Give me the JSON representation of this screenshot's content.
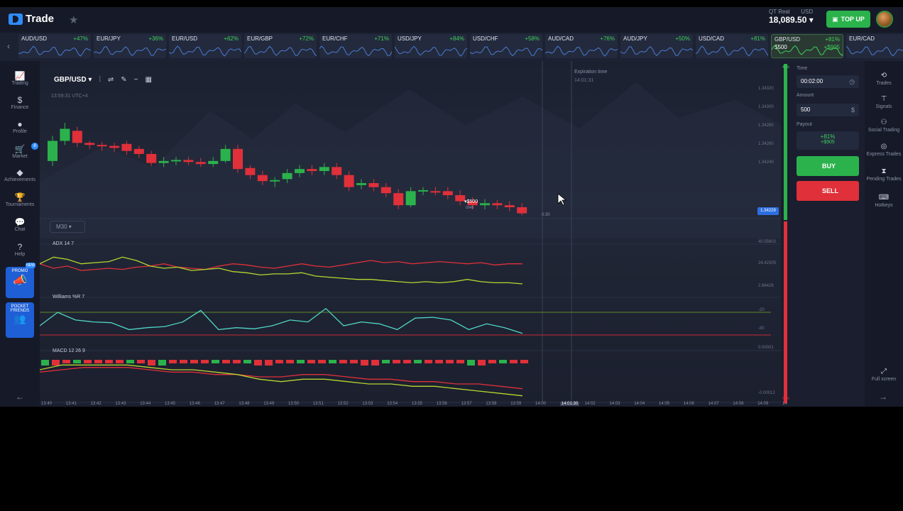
{
  "header": {
    "logo_text": "Trade",
    "account_type": "QT Real",
    "currency": "USD",
    "balance": "18,089.50",
    "topup_label": "TOP UP"
  },
  "assets": [
    {
      "name": "AUD/USD",
      "pct": "+47%"
    },
    {
      "name": "EUR/JPY",
      "pct": "+36%"
    },
    {
      "name": "EUR/USD",
      "pct": "+62%"
    },
    {
      "name": "EUR/GBP",
      "pct": "+72%"
    },
    {
      "name": "EUR/CHF",
      "pct": "+71%"
    },
    {
      "name": "USD/JPY",
      "pct": "+84%"
    },
    {
      "name": "USD/CHF",
      "pct": "+58%"
    },
    {
      "name": "AUD/CAD",
      "pct": "+76%"
    },
    {
      "name": "AUD/JPY",
      "pct": "+50%"
    },
    {
      "name": "USD/CAD",
      "pct": "+81%"
    },
    {
      "name": "GBP/USD",
      "pct": "+81%",
      "sub": "$500",
      "sub2": "+$905",
      "active": true
    },
    {
      "name": "EUR/CAD",
      "pct": ""
    }
  ],
  "leftnav": [
    {
      "icon": "chart-icon",
      "glyph": "📈",
      "label": "Trading"
    },
    {
      "icon": "dollar-icon",
      "glyph": "$",
      "label": "Finance"
    },
    {
      "icon": "user-icon",
      "glyph": "●",
      "label": "Profile"
    },
    {
      "icon": "cart-icon",
      "glyph": "🛒",
      "label": "Market",
      "badge": "8"
    },
    {
      "icon": "diamond-icon",
      "glyph": "◆",
      "label": "Achievements"
    },
    {
      "icon": "trophy-icon",
      "glyph": "🏆",
      "label": "Tournaments"
    },
    {
      "icon": "chat-icon",
      "glyph": "💬",
      "label": "Chat"
    },
    {
      "icon": "help-icon",
      "glyph": "?",
      "label": "Help"
    }
  ],
  "promo": {
    "label": "PROMO",
    "badge": "NEW"
  },
  "pocket_friends": {
    "label": "POCKET FRIENDS"
  },
  "toolbar": {
    "pair": "GBP/USD",
    "badge1": "5M",
    "badge2": "3"
  },
  "chart_info": {
    "timestamp": "13:59:31 UTC+4",
    "timeframe": "M30"
  },
  "expiration": {
    "label": "Expiration time",
    "time": "14:01:31"
  },
  "trade_marker": {
    "amount": "$500",
    "id": "0048"
  },
  "price_labels": [
    "1.34320",
    "1.34300",
    "1.34280",
    "1.34260",
    "1.34240"
  ],
  "current_price": "1.34229",
  "countdown": "0:30",
  "indicators": {
    "adx": {
      "label": "ADX 14 7",
      "vals": [
        "40.55602",
        "24.42305",
        "2.86426"
      ]
    },
    "williams": {
      "label": "Williams %R 7",
      "vals": [
        "-20",
        "-80"
      ]
    },
    "macd": {
      "label": "MACD 12 26 9",
      "vals": [
        "0.00001",
        "-0.00012"
      ]
    }
  },
  "time_labels": [
    "13:40",
    "13:41",
    "13:42",
    "13:43",
    "13:44",
    "13:45",
    "13:46",
    "13:47",
    "13:48",
    "13:49",
    "13:50",
    "13:51",
    "13:52",
    "13:53",
    "13:54",
    "13:55",
    "13:56",
    "13:57",
    "13:58",
    "13:59",
    "14:00",
    "14:01:30",
    "14:02",
    "14:03",
    "14:04",
    "14:05",
    "14:06",
    "14:07",
    "14:08",
    "14:09",
    "14"
  ],
  "volume_labels": {
    "top": "40%",
    "bottom": "60%"
  },
  "trade_panel": {
    "time_label": "Time",
    "time_value": "00:02:00",
    "amount_label": "Amount",
    "amount_value": "500",
    "payout_label": "Payout",
    "payout_pct": "+81%",
    "payout_amount": "+$905",
    "buy_label": "BUY",
    "sell_label": "SELL"
  },
  "rightnav": [
    {
      "icon": "history-icon",
      "glyph": "⟲",
      "label": "Trades"
    },
    {
      "icon": "signal-icon",
      "glyph": "⊤",
      "label": "Signals"
    },
    {
      "icon": "people-icon",
      "glyph": "⚇",
      "label": "Social Trading"
    },
    {
      "icon": "express-icon",
      "glyph": "◎",
      "label": "Express Trades"
    },
    {
      "icon": "hourglass-icon",
      "glyph": "⧗",
      "label": "Pending Trades"
    },
    {
      "icon": "keyboard-icon",
      "glyph": "⌨",
      "label": "Hotkeys"
    }
  ],
  "fullscreen": {
    "label": "Full screen"
  },
  "colors": {
    "green": "#2bb24c",
    "red": "#e0303a",
    "accent": "#2f8cff",
    "bg": "#1a1e2e"
  },
  "chart_data": {
    "type": "candlestick",
    "candles": [
      {
        "o": 1.3428,
        "c": 1.343,
        "h": 1.34305,
        "l": 1.34275
      },
      {
        "o": 1.343,
        "c": 1.34312,
        "h": 1.34318,
        "l": 1.34296
      },
      {
        "o": 1.3431,
        "c": 1.34298,
        "h": 1.34314,
        "l": 1.34294
      },
      {
        "o": 1.34298,
        "c": 1.34296,
        "h": 1.343,
        "l": 1.34292
      },
      {
        "o": 1.34296,
        "c": 1.34295,
        "h": 1.34299,
        "l": 1.3429
      },
      {
        "o": 1.34295,
        "c": 1.34293,
        "h": 1.34298,
        "l": 1.34289
      },
      {
        "o": 1.34297,
        "c": 1.3429,
        "h": 1.343,
        "l": 1.34286
      },
      {
        "o": 1.34292,
        "c": 1.34287,
        "h": 1.34295,
        "l": 1.34283
      },
      {
        "o": 1.34287,
        "c": 1.34278,
        "h": 1.3429,
        "l": 1.34275
      },
      {
        "o": 1.34278,
        "c": 1.3428,
        "h": 1.34284,
        "l": 1.34274
      },
      {
        "o": 1.3428,
        "c": 1.34281,
        "h": 1.34284,
        "l": 1.34276
      },
      {
        "o": 1.34281,
        "c": 1.34279,
        "h": 1.34284,
        "l": 1.34276
      },
      {
        "o": 1.34279,
        "c": 1.34277,
        "h": 1.34283,
        "l": 1.34274
      },
      {
        "o": 1.34277,
        "c": 1.3428,
        "h": 1.34284,
        "l": 1.34274
      },
      {
        "o": 1.3428,
        "c": 1.34292,
        "h": 1.34296,
        "l": 1.34278
      },
      {
        "o": 1.34292,
        "c": 1.34272,
        "h": 1.34296,
        "l": 1.34268
      },
      {
        "o": 1.34273,
        "c": 1.34266,
        "h": 1.34276,
        "l": 1.34262
      },
      {
        "o": 1.34266,
        "c": 1.3426,
        "h": 1.3427,
        "l": 1.34256
      },
      {
        "o": 1.3426,
        "c": 1.34261,
        "h": 1.34264,
        "l": 1.34254
      },
      {
        "o": 1.34262,
        "c": 1.34268,
        "h": 1.34272,
        "l": 1.34258
      },
      {
        "o": 1.34268,
        "c": 1.34272,
        "h": 1.34276,
        "l": 1.34264
      },
      {
        "o": 1.34272,
        "c": 1.3427,
        "h": 1.34276,
        "l": 1.34266
      },
      {
        "o": 1.3427,
        "c": 1.34274,
        "h": 1.34278,
        "l": 1.34266
      },
      {
        "o": 1.34274,
        "c": 1.34266,
        "h": 1.34278,
        "l": 1.34262
      },
      {
        "o": 1.34266,
        "c": 1.34254,
        "h": 1.3427,
        "l": 1.3425
      },
      {
        "o": 1.34256,
        "c": 1.34258,
        "h": 1.34262,
        "l": 1.34252
      },
      {
        "o": 1.34258,
        "c": 1.34254,
        "h": 1.34262,
        "l": 1.3425
      },
      {
        "o": 1.34254,
        "c": 1.34248,
        "h": 1.34258,
        "l": 1.34244
      },
      {
        "o": 1.34248,
        "c": 1.34236,
        "h": 1.34252,
        "l": 1.34232
      },
      {
        "o": 1.34236,
        "c": 1.3425,
        "h": 1.34254,
        "l": 1.34234
      },
      {
        "o": 1.3425,
        "c": 1.34251,
        "h": 1.34254,
        "l": 1.34246
      },
      {
        "o": 1.3425,
        "c": 1.34249,
        "h": 1.34254,
        "l": 1.34246
      },
      {
        "o": 1.3425,
        "c": 1.34246,
        "h": 1.34254,
        "l": 1.34242
      },
      {
        "o": 1.34246,
        "c": 1.3424,
        "h": 1.34251,
        "l": 1.34236
      },
      {
        "o": 1.3424,
        "c": 1.34236,
        "h": 1.34244,
        "l": 1.34232
      },
      {
        "o": 1.34236,
        "c": 1.34238,
        "h": 1.34242,
        "l": 1.34232
      },
      {
        "o": 1.34238,
        "c": 1.34236,
        "h": 1.34241,
        "l": 1.34232
      },
      {
        "o": 1.34236,
        "c": 1.34234,
        "h": 1.3424,
        "l": 1.3423
      },
      {
        "o": 1.34234,
        "c": 1.34228,
        "h": 1.34238,
        "l": 1.34226
      }
    ],
    "ylim": [
      1.3421,
      1.3433
    ],
    "adx_red": [
      30,
      26,
      28,
      24,
      25,
      26,
      25,
      27,
      28,
      30,
      27,
      26,
      25,
      28,
      30,
      29,
      27,
      26,
      28,
      30,
      28,
      27,
      29,
      31,
      33,
      31,
      32,
      30,
      31,
      32,
      31,
      30,
      31,
      29,
      30,
      30
    ],
    "adx_green": [
      30,
      36,
      34,
      30,
      31,
      32,
      36,
      33,
      28,
      26,
      27,
      24,
      25,
      26,
      23,
      22,
      20,
      21,
      21,
      22,
      19,
      18,
      17,
      16,
      16,
      15,
      14,
      13,
      14,
      13,
      14,
      16,
      14,
      13,
      13,
      12
    ],
    "williams": [
      -50,
      -15,
      -35,
      -40,
      -42,
      -60,
      -55,
      -52,
      -40,
      -10,
      -60,
      -55,
      -58,
      -50,
      -35,
      -40,
      -5,
      -50,
      -40,
      -45,
      -60,
      -30,
      -28,
      -35,
      -60,
      -45,
      -55,
      -70
    ],
    "macd_red": [
      -4,
      -3,
      -2,
      -2,
      -2,
      -3,
      -4,
      -4,
      -5,
      -5,
      -6,
      -6,
      -5,
      -5,
      -6,
      -7,
      -7,
      -8,
      -8,
      -9,
      -9,
      -10,
      -11
    ],
    "macd_green": [
      -3,
      -1,
      -1,
      -1,
      -1,
      -2,
      -3,
      -3,
      -4,
      -5,
      -7,
      -8,
      -7,
      -7,
      -8,
      -9,
      -9,
      -10,
      -10,
      -11,
      -12,
      -13,
      -14
    ]
  }
}
